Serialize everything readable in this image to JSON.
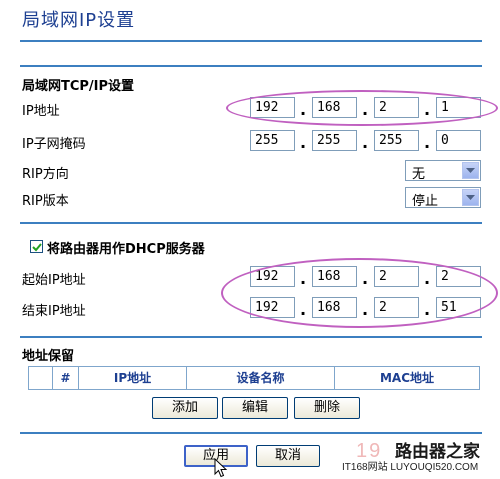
{
  "page_title": "局域网IP设置",
  "lan": {
    "section_title": "局域网TCP/IP设置",
    "ip_label": "IP地址",
    "ip": [
      "192",
      "168",
      "2",
      "1"
    ],
    "mask_label": "IP子网掩码",
    "mask": [
      "255",
      "255",
      "255",
      "0"
    ],
    "rip_direction_label": "RIP方向",
    "rip_direction_value": "无",
    "rip_version_label": "RIP版本",
    "rip_version_value": "停止"
  },
  "dhcp": {
    "checkbox_label": "将路由器用作DHCP服务器",
    "checked": true,
    "start_label": "起始IP地址",
    "start_ip": [
      "192",
      "168",
      "2",
      "2"
    ],
    "end_label": "结束IP地址",
    "end_ip": [
      "192",
      "168",
      "2",
      "51"
    ]
  },
  "reservation": {
    "section_title": "地址保留",
    "columns": [
      "#",
      "IP地址",
      "设备名称",
      "MAC地址"
    ],
    "buttons": {
      "add": "添加",
      "edit": "编辑",
      "delete": "删除"
    }
  },
  "footer": {
    "apply": "应用",
    "cancel": "取消"
  },
  "watermark": {
    "brand": "路由器之家",
    "digits": "19",
    "site": "IT168网站 LUYOUQI520.COM"
  },
  "colors": {
    "title": "#1d3f91",
    "rule": "#3c7fc0",
    "highlight_oval": "#c060c0"
  }
}
